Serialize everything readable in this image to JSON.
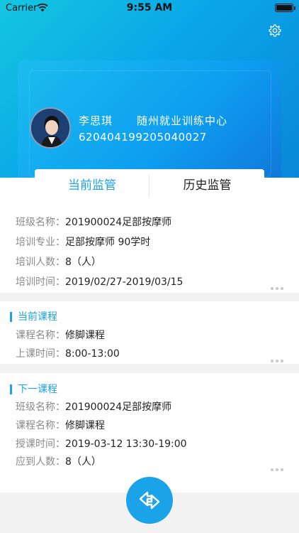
{
  "status_bar": {
    "carrier": "Carrier",
    "time": "9:55 AM"
  },
  "profile": {
    "name": "李思琪",
    "organization": "随州就业训练中心",
    "id_number": "620404199205040027"
  },
  "tabs": [
    {
      "label": "当前监管",
      "active": true
    },
    {
      "label": "历史监管",
      "active": false
    }
  ],
  "class_info": {
    "rows": [
      {
        "label": "班级名称：",
        "value": "201900024足部按摩师"
      },
      {
        "label": "培训专业：",
        "value": "足部按摩师 90学时"
      },
      {
        "label": "培训人数：",
        "value": "8（人）"
      },
      {
        "label": "培训时间：",
        "value": "2019/02/27-2019/03/15"
      }
    ]
  },
  "current_course": {
    "title": "当前课程",
    "rows": [
      {
        "label": "课程名称：",
        "value": "修脚课程"
      },
      {
        "label": "上课时间：",
        "value": "8:00-13:00"
      }
    ]
  },
  "next_course": {
    "title": "下一课程",
    "rows": [
      {
        "label": "班级名称：",
        "value": "201900024足部按摩师"
      },
      {
        "label": "课程名称：",
        "value": "修脚课程"
      },
      {
        "label": "授课时间：",
        "value": "2019-03-12 13:30-19:00"
      },
      {
        "label": "应到人数：",
        "value": "8（人）"
      }
    ]
  },
  "colors": {
    "accent": "#1aa3e8",
    "header_start": "#14c6e0",
    "header_end": "#0a86d8"
  },
  "icons": [
    "wifi-icon",
    "battery-icon",
    "gear-icon",
    "more-icon",
    "swap-arrows-icon"
  ]
}
